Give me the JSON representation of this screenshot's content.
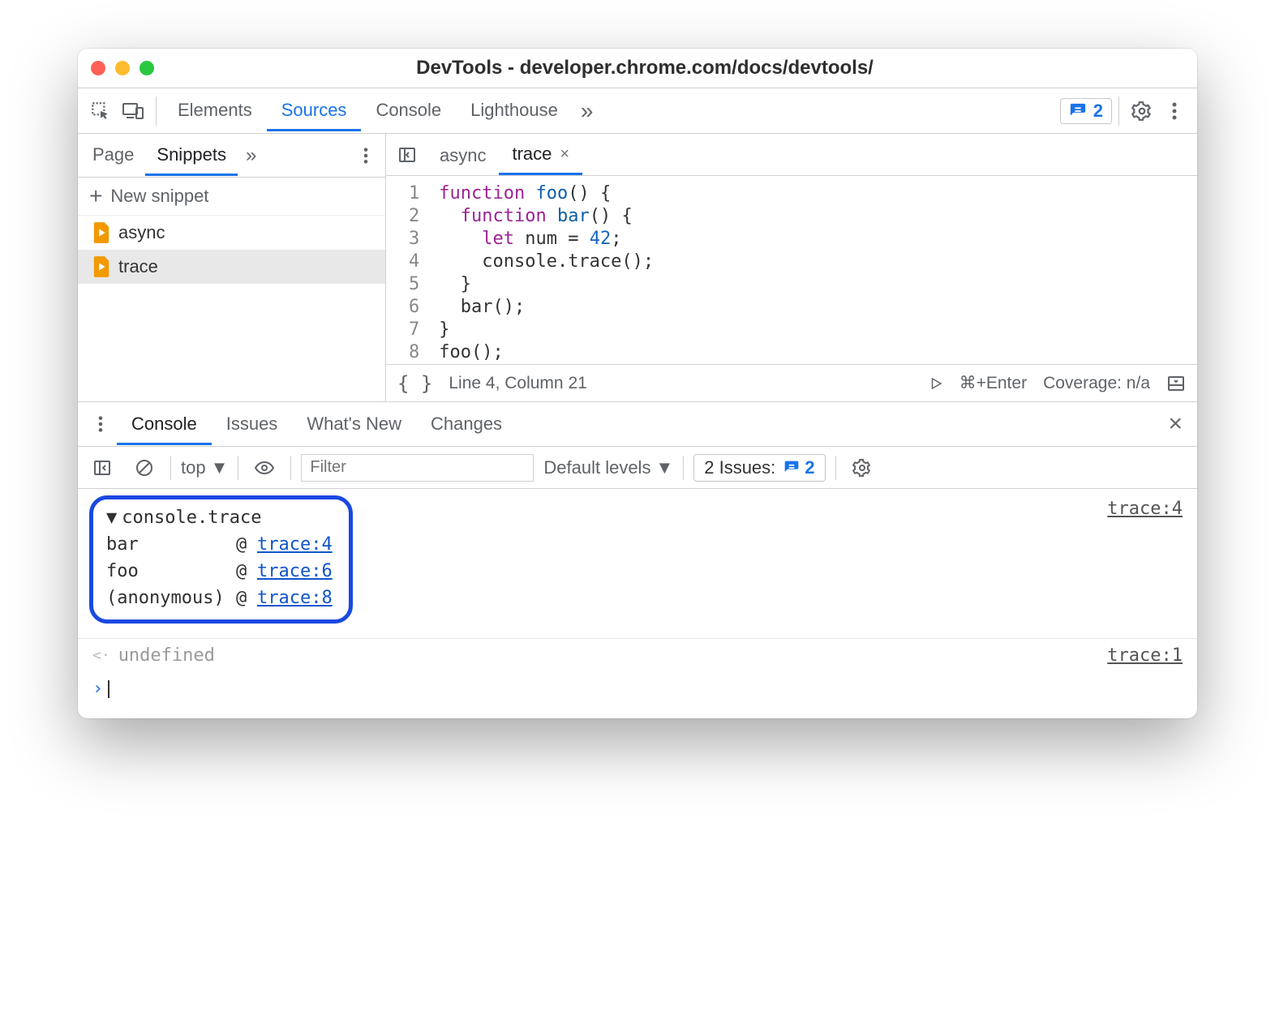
{
  "window": {
    "title": "DevTools - developer.chrome.com/docs/devtools/"
  },
  "toolbar": {
    "tabs": [
      "Elements",
      "Sources",
      "Console",
      "Lighthouse"
    ],
    "activeTab": "Sources",
    "issuesCount": "2"
  },
  "sidebar": {
    "tabs": [
      "Page",
      "Snippets"
    ],
    "activeTab": "Snippets",
    "newSnippet": "New snippet",
    "files": [
      "async",
      "trace"
    ],
    "selected": "trace"
  },
  "editor": {
    "tabs": [
      "async",
      "trace"
    ],
    "activeTab": "trace",
    "lines": [
      [
        {
          "t": "function ",
          "c": "kw"
        },
        {
          "t": "foo",
          "c": "fn"
        },
        {
          "t": "() {",
          "c": ""
        }
      ],
      [
        {
          "t": "  function ",
          "c": "kw"
        },
        {
          "t": "bar",
          "c": "fn"
        },
        {
          "t": "() {",
          "c": ""
        }
      ],
      [
        {
          "t": "    let ",
          "c": "kw"
        },
        {
          "t": "num = ",
          "c": ""
        },
        {
          "t": "42",
          "c": "num"
        },
        {
          "t": ";",
          "c": ""
        }
      ],
      [
        {
          "t": "    console.trace();",
          "c": ""
        }
      ],
      [
        {
          "t": "  }",
          "c": ""
        }
      ],
      [
        {
          "t": "  bar();",
          "c": ""
        }
      ],
      [
        {
          "t": "}",
          "c": ""
        }
      ],
      [
        {
          "t": "foo();",
          "c": ""
        }
      ]
    ]
  },
  "statusbar": {
    "pos": "Line 4, Column 21",
    "run": "⌘+Enter",
    "cov": "Coverage: n/a"
  },
  "drawer": {
    "tabs": [
      "Console",
      "Issues",
      "What's New",
      "Changes"
    ],
    "activeTab": "Console"
  },
  "consoleToolbar": {
    "context": "top",
    "filterPlaceholder": "Filter",
    "levels": "Default levels",
    "issuesLabel": "2 Issues:",
    "issuesCount": "2"
  },
  "consoleOut": {
    "traceLabel": "console.trace",
    "srcRight": "trace:4",
    "stack": [
      {
        "name": "bar",
        "loc": "trace:4"
      },
      {
        "name": "foo",
        "loc": "trace:6"
      },
      {
        "name": "(anonymous)",
        "loc": "trace:8"
      }
    ],
    "undef": "undefined",
    "undefSrc": "trace:1"
  }
}
